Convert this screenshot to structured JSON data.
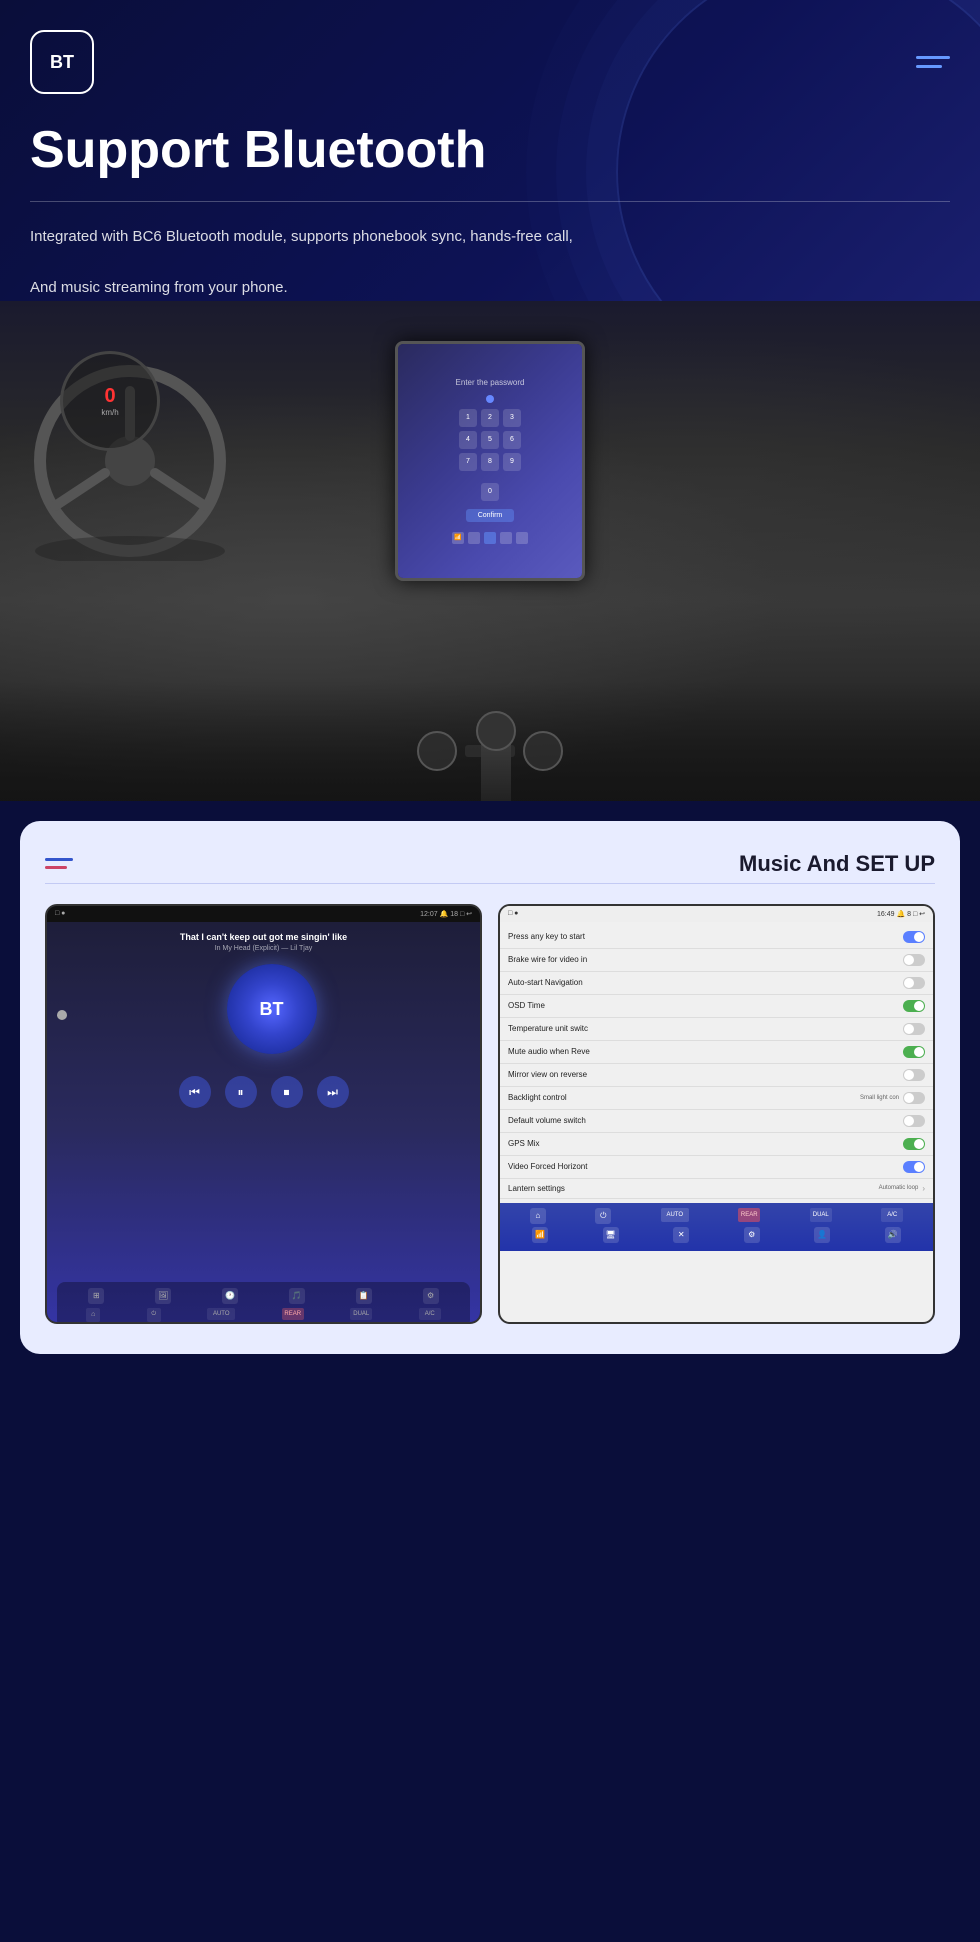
{
  "header": {
    "logo_text": "BT",
    "title": "Support Bluetooth",
    "description_line1": "Integrated with BC6 Bluetooth module, supports phonebook sync, hands-free call,",
    "description_line2": "And music streaming from your phone."
  },
  "music_setup": {
    "section_title": "Music And SET UP",
    "music_player": {
      "song_title": "That I can't keep out got me singin' like",
      "song_subtitle": "In My Head (Explicit) — Lil Tjay",
      "album_label": "BT",
      "controls": [
        "⏮",
        "⏸",
        "⏹",
        "⏭"
      ]
    },
    "settings_screen": {
      "time": "16:49",
      "rows": [
        {
          "label": "Press any key to start",
          "toggle": "blue-on",
          "extra": ""
        },
        {
          "label": "Brake wire for video in",
          "toggle": "off",
          "extra": ""
        },
        {
          "label": "Auto-start Navigation",
          "toggle": "off",
          "extra": ""
        },
        {
          "label": "OSD Time",
          "toggle": "on",
          "extra": ""
        },
        {
          "label": "Temperature unit switc",
          "toggle": "off",
          "extra": ""
        },
        {
          "label": "Mute audio when Reve",
          "toggle": "on",
          "extra": ""
        },
        {
          "label": "Mirror view on reverse",
          "toggle": "off",
          "extra": ""
        },
        {
          "label": "Backlight control",
          "toggle": "off",
          "extra": "Small light con"
        },
        {
          "label": "Default volume switch",
          "toggle": "off",
          "extra": ""
        },
        {
          "label": "GPS Mix",
          "toggle": "on",
          "extra": ""
        },
        {
          "label": "Video Forced Horizont",
          "toggle": "blue-on",
          "extra": ""
        },
        {
          "label": "Lantern settings",
          "toggle": "arrow",
          "extra": "Automatic loop"
        }
      ]
    }
  }
}
